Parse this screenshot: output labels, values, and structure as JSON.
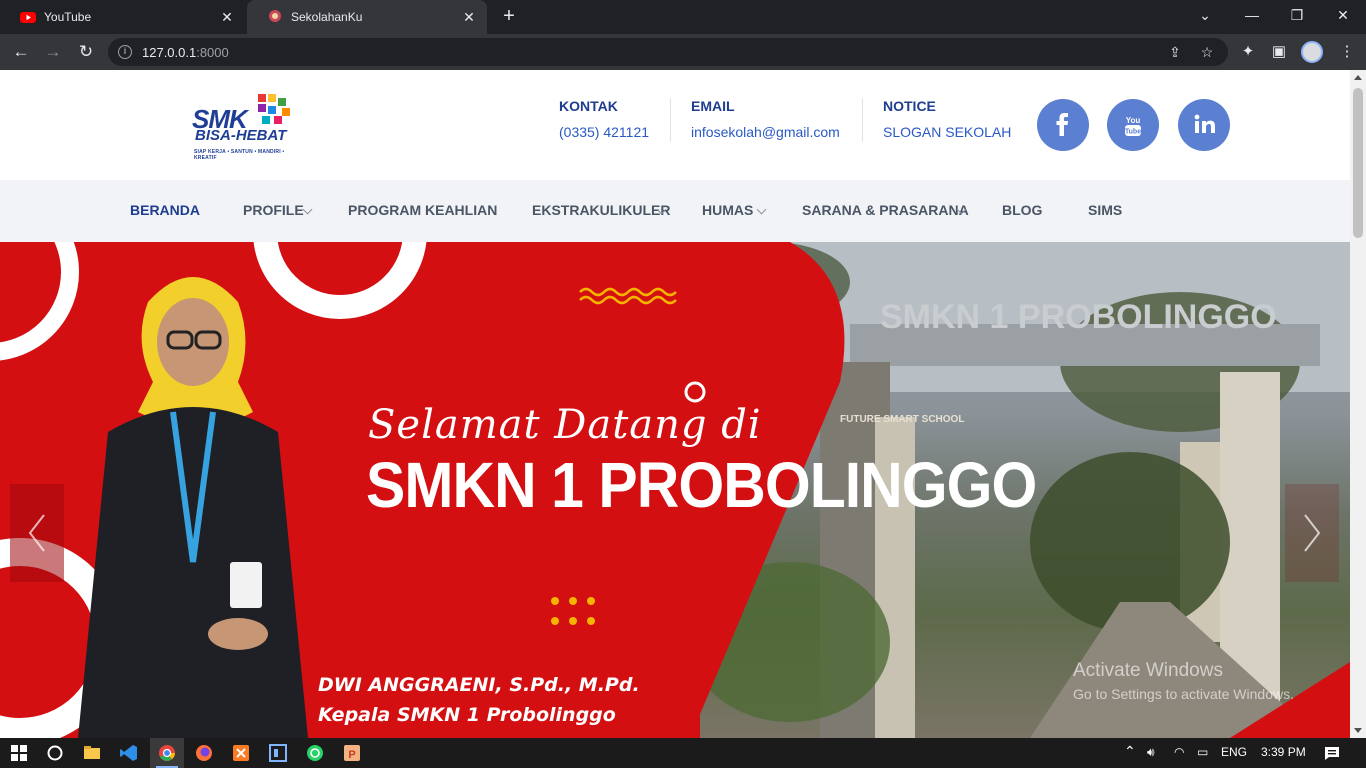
{
  "browser": {
    "tabs": [
      {
        "title": "YouTube",
        "active": false
      },
      {
        "title": "SekolahanKu",
        "active": true
      }
    ],
    "url_host": "127.0.0.1",
    "url_port": ":8000"
  },
  "header": {
    "logo": {
      "line1": "SMK",
      "line2": "BISA-HEBAT",
      "tagline": "SIAP KERJA • SANTUN • MANDIRI • KREATIF"
    },
    "contacts": [
      {
        "label": "KONTAK",
        "value": "(0335) 421121"
      },
      {
        "label": "EMAIL",
        "value": "infosekolah@gmail.com"
      },
      {
        "label": "NOTICE",
        "value": "SLOGAN SEKOLAH"
      }
    ],
    "social": [
      "facebook-icon",
      "youtube-icon",
      "linkedin-icon"
    ]
  },
  "menu": {
    "items": [
      {
        "label": "BERANDA",
        "dropdown": false,
        "active": true
      },
      {
        "label": "PROFILE",
        "dropdown": true,
        "active": false
      },
      {
        "label": "PROGRAM KEAHLIAN",
        "dropdown": false,
        "active": false
      },
      {
        "label": "EKSTRAKULIKULER",
        "dropdown": true,
        "active": false
      },
      {
        "label": "HUMAS",
        "dropdown": true,
        "active": false
      },
      {
        "label": "SARANA & PRASARANA",
        "dropdown": true,
        "active": false
      },
      {
        "label": "BLOG",
        "dropdown": false,
        "active": false
      },
      {
        "label": "SIMS",
        "dropdown": false,
        "active": false
      }
    ]
  },
  "hero": {
    "title_line1": "Selamat Datang di",
    "title_line2": "SMKN 1 PROBOLINGGO",
    "name": "DWI ANGGRAENI, S.Pd., M.Pd.",
    "role": "Kepala SMKN 1 Probolinggo",
    "gate_sign": "SMKN 1 PROBOLINGGO",
    "wall_text": "FUTURE SMART SCHOOL"
  },
  "watermark": {
    "line1": "Activate Windows",
    "line2": "Go to Settings to activate Windows."
  },
  "taskbar": {
    "language": "ENG",
    "time": "3:39 PM"
  },
  "colors": {
    "brand_blue": "#1e3d8f",
    "hero_red": "#d40f12",
    "social_blue": "#5b7fd1"
  }
}
